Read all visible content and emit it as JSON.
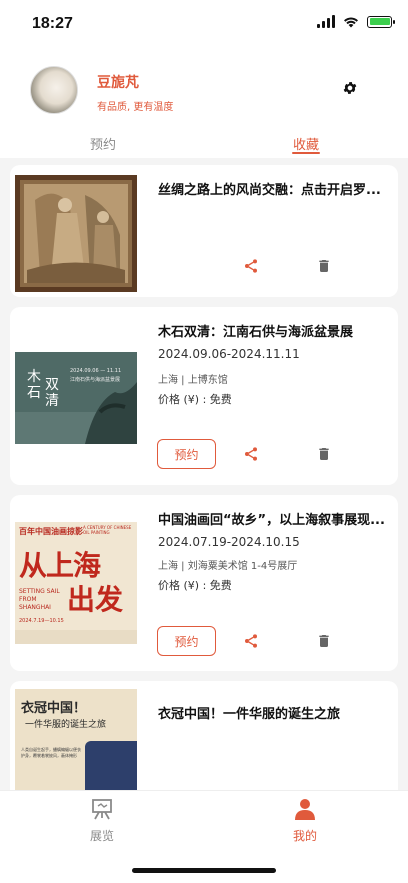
{
  "status_bar": {
    "time": "18:27"
  },
  "profile": {
    "name": "豆旎芃",
    "tagline": "有品质, 更有温度"
  },
  "tabs": [
    {
      "label": "预约",
      "active": false
    },
    {
      "label": "收藏",
      "active": true
    }
  ],
  "cards": [
    {
      "title": "丝绸之路上的风尚交融：点击开启罗...",
      "date": "",
      "venue": "",
      "price": "",
      "reserve_label": ""
    },
    {
      "title": "木石双清：江南石供与海派盆景展",
      "date": "2024.09.06-2024.11.11",
      "venue": "上海 | 上博东馆",
      "price": "价格 (¥) : 免费",
      "reserve_label": "预约",
      "poster": {
        "big_a": "木",
        "big_b": "石",
        "big_c": "双",
        "big_d": "清",
        "subtitle": "2024.09.06 — 11.11",
        "subtitle2": "江南石供与海派盆景展"
      }
    },
    {
      "title": "中国油画回“故乡”，以上海叙事展现...",
      "date": "2024.07.19-2024.10.15",
      "venue": "上海 | 刘海粟美术馆 1-4号展厅",
      "price": "价格 (¥) : 免费",
      "reserve_label": "预约",
      "poster": {
        "top_cn": "百年中国油画掠影",
        "top_en": "A CENTURY OF CHINESE OIL PAINTING",
        "line1": "从上海",
        "line2": "出发",
        "en1": "SETTING SAIL",
        "en2": "FROM",
        "en3": "SHANGHAI",
        "dates": "2024.7.19—10.15"
      }
    },
    {
      "title": "衣冠中国！一件华服的诞生之旅",
      "date": "",
      "venue": "",
      "price": "",
      "reserve_label": "",
      "poster": {
        "line1": "衣冠中国！",
        "line2": "一件华服的诞生之旅",
        "blurb": "人类自诞生起手，蟠螭蝙蝠以便衣护身，覆裳着裳披风，蔽体掩形"
      }
    }
  ],
  "bottom_nav": [
    {
      "label": "展览",
      "icon": "easel-icon",
      "active": false
    },
    {
      "label": "我的",
      "icon": "person-icon",
      "active": true
    }
  ],
  "colors": {
    "accent": "#e05a3c",
    "inactive": "#8a8a8a"
  }
}
